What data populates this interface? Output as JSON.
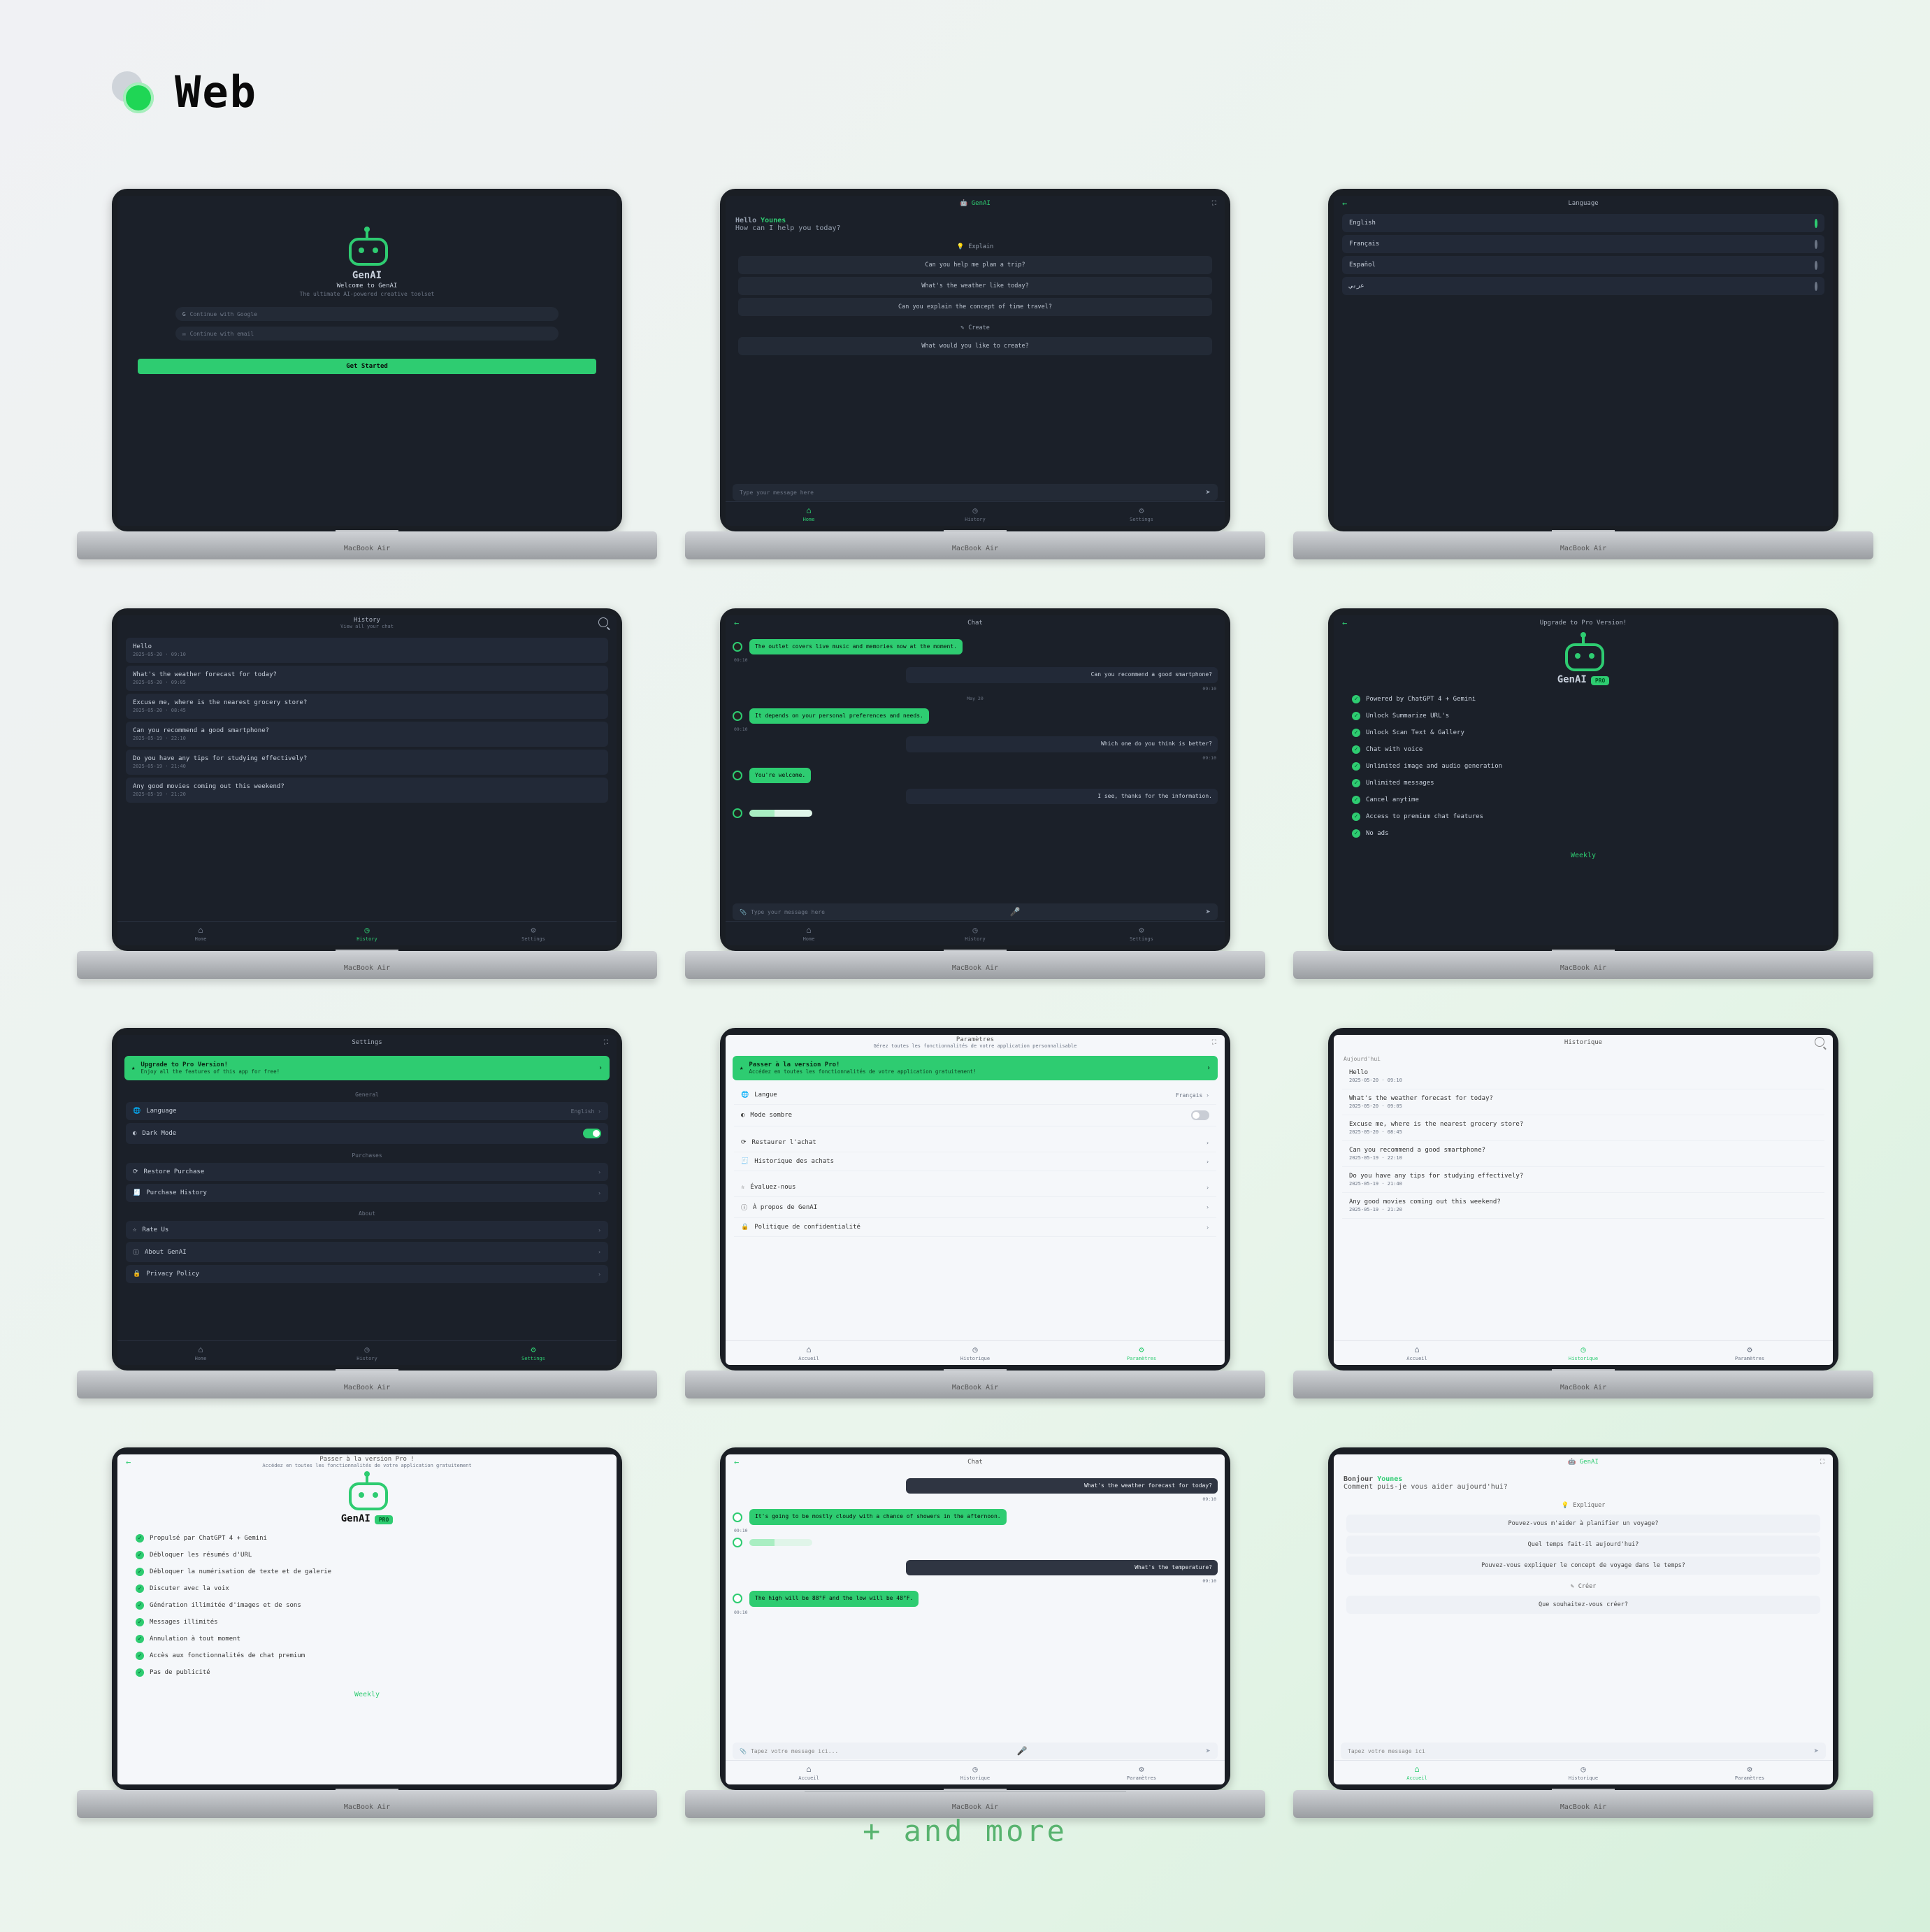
{
  "page_title": "Web",
  "footer_more": "+ and more",
  "laptop_brand": "MacBook Air",
  "tabs_en": [
    "Home",
    "History",
    "Settings"
  ],
  "tabs_fr": [
    "Accueil",
    "Historique",
    "Paramètres"
  ],
  "s1": {
    "app_name": "GenAI",
    "welcome": "Welcome to GenAI",
    "tagline": "The ultimate AI-powered creative toolset",
    "signin_placeholder": "Continue with Google",
    "email_placeholder": "Continue with email",
    "get_started": "Get Started"
  },
  "s2": {
    "brand": "GenAI",
    "greet_prefix": "Hello",
    "greet_name": "Younes",
    "greet_sub": "How can I help you today?",
    "explain_title": "Explain",
    "explain_items": [
      "Can you help me plan a trip?",
      "What's the weather like today?",
      "Can you explain the concept of time travel?"
    ],
    "create_title": "Create",
    "create_items": [
      "What would you like to create?"
    ],
    "input_ph": "Type your message here"
  },
  "s3": {
    "title": "Language",
    "items": [
      {
        "label": "English",
        "selected": true
      },
      {
        "label": "Français",
        "selected": false
      },
      {
        "label": "Español",
        "selected": false
      },
      {
        "label": "عربي",
        "selected": false
      }
    ]
  },
  "s4": {
    "title": "History",
    "subtitle": "View all your chat",
    "items": [
      {
        "q": "Hello",
        "meta": "2025-05-20 · 09:10"
      },
      {
        "q": "What's the weather forecast for today?",
        "meta": "2025-05-20 · 09:05"
      },
      {
        "q": "Excuse me, where is the nearest grocery store?",
        "meta": "2025-05-20 · 08:45"
      },
      {
        "q": "Can you recommend a good smartphone?",
        "meta": "2025-05-19 · 22:10"
      },
      {
        "q": "Do you have any tips for studying effectively?",
        "meta": "2025-05-19 · 21:40"
      },
      {
        "q": "Any good movies coming out this weekend?",
        "meta": "2025-05-19 · 21:20"
      }
    ]
  },
  "s5": {
    "title": "Chat",
    "date1": "May 20",
    "ai1": "The outlet covers live music and memories now at the moment.",
    "user1": "Can you recommend a good smartphone?",
    "ai2": "It depends on your personal preferences and needs.",
    "user2": "Which one do you think is better?",
    "ai3": "You're welcome.",
    "user3": "I see, thanks for the information.",
    "input_ph": "Type your message here",
    "ts": "09:10"
  },
  "s6": {
    "title": "Upgrade to Pro Version!",
    "app_name": "GenAI",
    "badge": "PRO",
    "features": [
      "Powered by ChatGPT 4 + Gemini",
      "Unlock Summarize URL's",
      "Unlock Scan Text & Gallery",
      "Chat with voice",
      "Unlimited image and audio generation",
      "Unlimited messages",
      "Cancel anytime",
      "Access to premium chat features",
      "No ads"
    ],
    "weekly": "Weekly"
  },
  "s7": {
    "title": "Settings",
    "banner_title": "Upgrade to Pro Version!",
    "banner_sub": "Enjoy all the features of this app for free!",
    "sec_general": "General",
    "row_language": "Language",
    "row_language_val": "English",
    "row_dark": "Dark Mode",
    "sec_purchases": "Purchases",
    "row_restore": "Restore Purchase",
    "row_history": "Purchase History",
    "sec_about": "About",
    "row_rate": "Rate Us",
    "row_about": "About GenAI",
    "row_privacy": "Privacy Policy"
  },
  "s8": {
    "title": "Paramètres",
    "sub": "Gérez toutes les fonctionnalités de votre application personnalisable",
    "banner_title": "Passer à la version Pro!",
    "banner_sub": "Accédez en toutes les fonctionnalités de votre application gratuitement!",
    "row_language": "Langue",
    "row_language_val": "Français",
    "row_dark": "Mode sombre",
    "row_restore": "Restaurer l'achat",
    "row_history": "Historique des achats",
    "row_rate": "Évaluez-nous",
    "row_about": "À propos de GenAI",
    "row_privacy": "Politique de confidentialité"
  },
  "s9": {
    "title": "Historique",
    "today": "Aujourd'hui",
    "items": [
      {
        "q": "Hello",
        "meta": "2025-05-20 · 09:10"
      },
      {
        "q": "What's the weather forecast for today?",
        "meta": "2025-05-20 · 09:05"
      },
      {
        "q": "Excuse me, where is the nearest grocery store?",
        "meta": "2025-05-20 · 08:45"
      },
      {
        "q": "Can you recommend a good smartphone?",
        "meta": "2025-05-19 · 22:10"
      },
      {
        "q": "Do you have any tips for studying effectively?",
        "meta": "2025-05-19 · 21:40"
      },
      {
        "q": "Any good movies coming out this weekend?",
        "meta": "2025-05-19 · 21:20"
      }
    ]
  },
  "s10": {
    "title": "Passer à la version Pro !",
    "sub": "Accédez en toutes les fonctionnalités de votre application gratuitement",
    "app_name": "GenAI",
    "badge": "PRO",
    "features": [
      "Propulsé par ChatGPT 4 + Gemini",
      "Débloquer les résumés d'URL",
      "Débloquer la numérisation de texte et de galerie",
      "Discuter avec la voix",
      "Génération illimitée d'images et de sons",
      "Messages illimités",
      "Annulation à tout moment",
      "Accès aux fonctionnalités de chat premium",
      "Pas de publicité"
    ],
    "weekly": "Weekly"
  },
  "s11": {
    "title": "Chat",
    "ai1": "It's going to be mostly cloudy with a chance of showers in the afternoon.",
    "user1": "What's the weather forecast for today?",
    "ai2": "The high will be 88°F and the low will be 48°F.",
    "user2": "What's the temperature?",
    "input_ph": "Tapez votre message ici...",
    "ts": "09:10"
  },
  "s12": {
    "brand": "GenAI",
    "greet_prefix": "Bonjour",
    "greet_name": "Younes",
    "greet_sub": "Comment puis-je vous aider aujourd'hui?",
    "explain_title": "Expliquer",
    "explain_items": [
      "Pouvez-vous m'aider à planifier un voyage?",
      "Quel temps fait-il aujourd'hui?",
      "Pouvez-vous expliquer le concept de voyage dans le temps?"
    ],
    "create_title": "Créer",
    "create_items": [
      "Que souhaitez-vous créer?"
    ],
    "input_ph": "Tapez votre message ici"
  }
}
